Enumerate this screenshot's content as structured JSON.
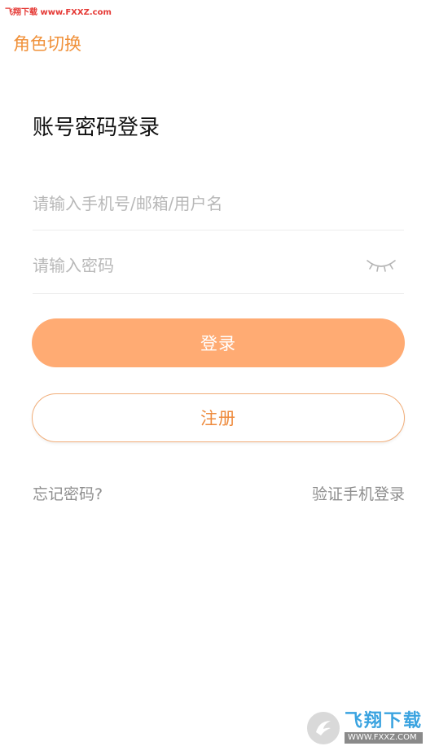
{
  "watermark": {
    "top_text": "飞翔下载 www.FXXZ.com",
    "logo_text": "飞翔下载",
    "logo_url": "WWW.FXXZ.COM"
  },
  "header": {
    "role_switch_label": "角色切换"
  },
  "main": {
    "title": "账号密码登录",
    "account_field": {
      "value": "",
      "placeholder": "请输入手机号/邮箱/用户名"
    },
    "password_field": {
      "value": "",
      "placeholder": "请输入密码",
      "toggle_icon": "eye-closed-icon"
    },
    "login_button_label": "登录",
    "register_button_label": "注册",
    "forgot_password_label": "忘记密码?",
    "sms_login_label": "验证手机登录"
  },
  "colors": {
    "accent": "#f0913a",
    "login_button_bg": "#ffab73",
    "register_border": "#f1ad78",
    "watermark_red": "#e53935",
    "logo_blue": "#3aa3e0",
    "muted_text": "#8f8f8f",
    "placeholder": "#b8b8b8"
  }
}
